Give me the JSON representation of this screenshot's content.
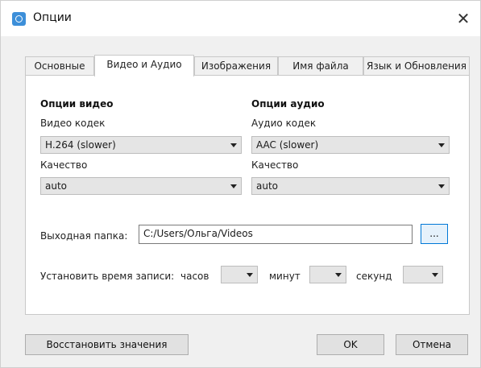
{
  "window": {
    "title": "Опции",
    "close_glyph": "✕"
  },
  "tabs": [
    {
      "label": "Основные"
    },
    {
      "label": "Видео и Аудио",
      "active": true
    },
    {
      "label": "Изображения"
    },
    {
      "label": "Имя файла"
    },
    {
      "label": "Язык и Обновления"
    }
  ],
  "video": {
    "heading": "Опции видео",
    "codec_label": "Видео кодек",
    "codec_value": "H.264 (slower)",
    "quality_label": "Качество",
    "quality_value": "auto"
  },
  "audio": {
    "heading": "Опции аудио",
    "codec_label": "Аудио кодек",
    "codec_value": "AAC (slower)",
    "quality_label": "Качество",
    "quality_value": "auto"
  },
  "output": {
    "label": "Выходная папка:",
    "path": "C:/Users/Ольга/Videos",
    "browse_label": "..."
  },
  "timer": {
    "label": "Установить время записи:",
    "hours_label": "часов",
    "minutes_label": "минут",
    "seconds_label": "секунд",
    "hours_value": "",
    "minutes_value": "",
    "seconds_value": ""
  },
  "footer": {
    "restore_label": "Восстановить значения",
    "ok_label": "OK",
    "cancel_label": "Отмена"
  },
  "icons": {
    "app": "app-icon",
    "close": "close-icon",
    "dropdown": "chevron-down-icon"
  }
}
